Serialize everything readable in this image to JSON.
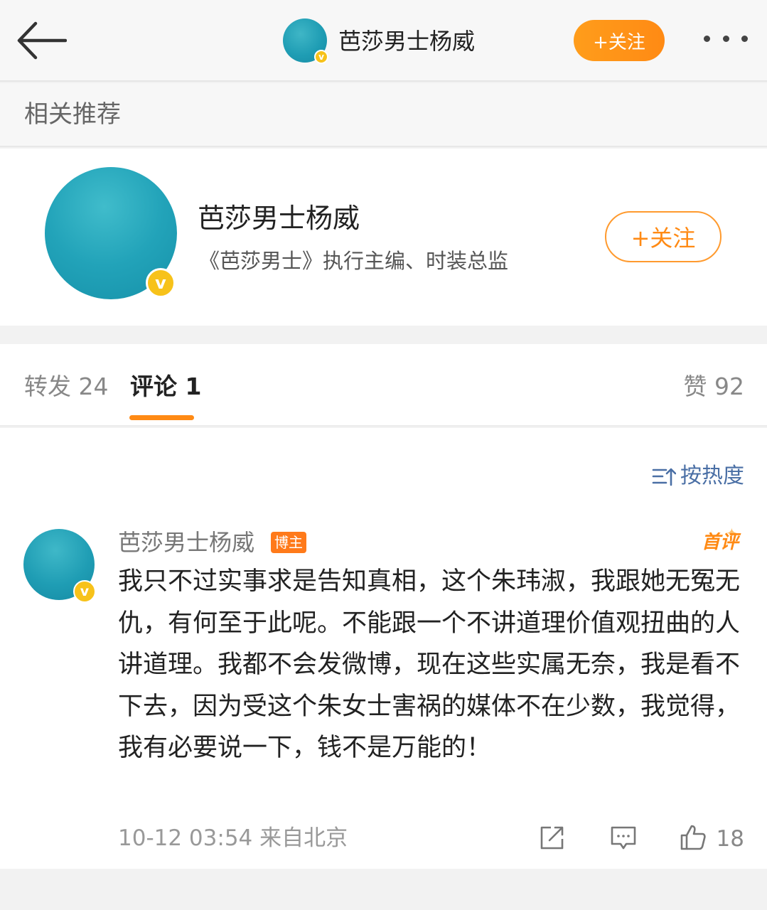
{
  "header": {
    "name": "芭莎男士杨威",
    "follow_label": "+关注"
  },
  "recommend": {
    "title": "相关推荐",
    "user": {
      "name": "芭莎男士杨威",
      "description": "《芭莎男士》执行主编、时装总监",
      "follow_label": "+关注"
    }
  },
  "tabs": {
    "repost": "转发 24",
    "comment": "评论 1",
    "like": "赞 92"
  },
  "sort": {
    "label": "按热度"
  },
  "comment": {
    "author": "芭莎男士杨威",
    "badge": "博主",
    "tag": "首评",
    "text": "我只不过实事求是告知真相，这个朱玮淑，我跟她无冤无仇，有何至于此呢。不能跟一个不讲道理价值观扭曲的人讲道理。我都不会发微博，现在这些实属无奈，我是看不下去，因为受这个朱女士害祸的媒体不在少数，我觉得，我有必要说一下，钱不是万能的！",
    "time": "10-12 03:54",
    "source": "来自北京",
    "like_count": "18"
  },
  "colors": {
    "accent": "#ff8a14",
    "verified": "#f7c21a",
    "link": "#4a6fa5"
  }
}
